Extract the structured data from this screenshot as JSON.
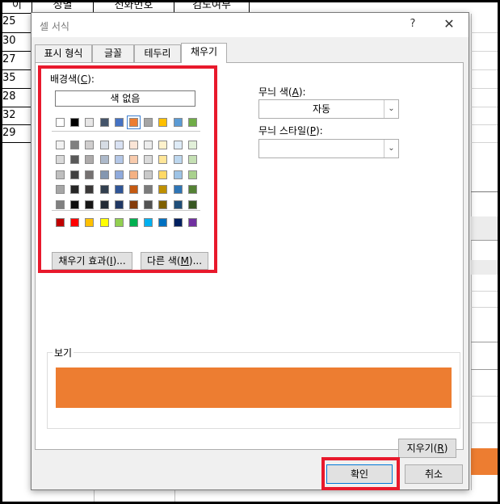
{
  "spreadsheet": {
    "header_cells": [
      "이",
      "성별",
      "전화번호",
      "검도여부"
    ],
    "row_values": [
      "25",
      "30",
      "27",
      "35",
      "28",
      "32",
      "29"
    ]
  },
  "dialog": {
    "title": "셀 서식",
    "help": "?",
    "close": "✕",
    "tabs": [
      "표시 형식",
      "글꼴",
      "테두리",
      "채우기"
    ],
    "active_tab": "채우기",
    "fill": {
      "background_label_prefix": "배경색(",
      "background_label_key": "C",
      "background_label_suffix": "):",
      "no_color_label": "색 없음",
      "theme_row": [
        "#ffffff",
        "#000000",
        "#e7e6e6",
        "#44546a",
        "#4472c4",
        "#ed7d31",
        "#a5a5a5",
        "#ffc000",
        "#5b9bd5",
        "#70ad47"
      ],
      "selected_color": "#ed7d31",
      "shade_rows": [
        [
          "#f2f2f2",
          "#7f7f7f",
          "#d0cece",
          "#d6dce4",
          "#d9e2f3",
          "#fbe5d6",
          "#ededed",
          "#fff2cc",
          "#deebf7",
          "#e2f0d9"
        ],
        [
          "#d9d9d9",
          "#595959",
          "#aeabab",
          "#adb9ca",
          "#b4c7e7",
          "#f8cbad",
          "#dbdbdb",
          "#ffe699",
          "#bdd7ee",
          "#c5e0b4"
        ],
        [
          "#bfbfbf",
          "#404040",
          "#757171",
          "#8497b0",
          "#8faadc",
          "#f4b183",
          "#c9c9c9",
          "#ffd966",
          "#9dc3e6",
          "#a9d18e"
        ],
        [
          "#a6a6a6",
          "#262626",
          "#3a3838",
          "#323f4f",
          "#2f5597",
          "#c55a11",
          "#7b7b7b",
          "#bf9000",
          "#2e75b6",
          "#548235"
        ],
        [
          "#808080",
          "#0d0d0d",
          "#171616",
          "#222a35",
          "#203864",
          "#843c0c",
          "#525252",
          "#7f6000",
          "#1f4e79",
          "#385723"
        ]
      ],
      "standard_row": [
        "#c00000",
        "#ff0000",
        "#ffc000",
        "#ffff00",
        "#92d050",
        "#00b050",
        "#00b0f0",
        "#0070c0",
        "#002060",
        "#7030a0"
      ],
      "fill_effects_prefix": "채우기 효과(",
      "fill_effects_key": "I",
      "fill_effects_suffix": ")...",
      "more_colors_prefix": "다른 색(",
      "more_colors_key": "M",
      "more_colors_suffix": ")...",
      "pattern_color_prefix": "무늬 색(",
      "pattern_color_key": "A",
      "pattern_color_suffix": "):",
      "pattern_color_value": "자동",
      "pattern_style_prefix": "무늬 스타일(",
      "pattern_style_key": "P",
      "pattern_style_suffix": "):",
      "pattern_style_value": "",
      "sample_label": "보기",
      "sample_color": "#ed7d31",
      "clear_prefix": "지우기(",
      "clear_key": "R",
      "clear_suffix": ")"
    },
    "ok_label": "확인",
    "cancel_label": "취소"
  },
  "highlight_color": "#e8192c"
}
